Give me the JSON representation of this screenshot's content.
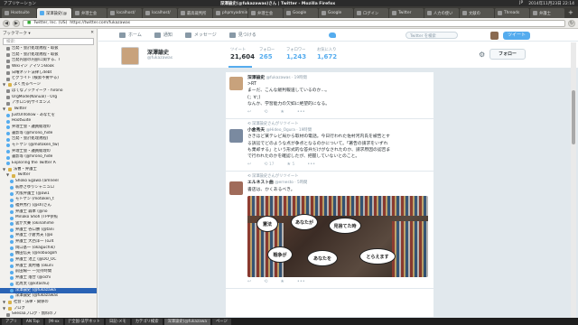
{
  "os": {
    "apps_label": "アプリケーション",
    "title": "深澤諭史(@fukazawas)さん | Twitter - Mozilla Firefox",
    "status": [
      "JP",
      "2014年11月23日 22:14"
    ]
  },
  "tabs": [
    {
      "label": "Hootsuite"
    },
    {
      "label": "深澤諭史(@"
    },
    {
      "label": "弁理士会"
    },
    {
      "label": "localhost/"
    },
    {
      "label": "localhost/"
    },
    {
      "label": "最高裁判所"
    },
    {
      "label": "phpmyadmin"
    },
    {
      "label": "弁理士会"
    },
    {
      "label": "Google"
    },
    {
      "label": "Google"
    },
    {
      "label": "ログイン"
    },
    {
      "label": "Twitter"
    },
    {
      "label": "人力の使い"
    },
    {
      "label": "文献の"
    },
    {
      "label": "Threads"
    },
    {
      "label": "弁護士"
    }
  ],
  "nav": {
    "back_glyph": "◀",
    "forward_glyph": "▶",
    "reload_glyph": "↻",
    "url_site": "Twitter, Inc. (US)",
    "url": "https://twitter.com/fukazawas"
  },
  "sidebar": {
    "title": "ブックマーク ▾",
    "search_placeholder": "検索:",
    "items": [
      {
        "label": "告発・会計処理規程・取扱",
        "type": "page",
        "indent": 1
      },
      {
        "label": "告発・会計処理規程・取扱",
        "type": "page",
        "indent": 1
      },
      {
        "label": "告発内容の内部に関する、T",
        "type": "page",
        "indent": 1
      },
      {
        "label": "Wikiマジ アマゾンBook",
        "type": "page",
        "indent": 1
      },
      {
        "label": "日曜ネット法律しdebt",
        "type": "page",
        "indent": 1
      },
      {
        "label": "ビグライト (検索不要やる)",
        "type": "page",
        "indent": 1
      },
      {
        "label": "よく見るページ",
        "type": "folder",
        "indent": 0
      },
      {
        "label": "はてなブックマーク - hirono",
        "type": "page",
        "indent": 1
      },
      {
        "label": "OrgMode(Nanual) - Org",
        "type": "page",
        "indent": 1
      },
      {
        "label": "アポロン的サイエンス",
        "type": "page",
        "indent": 1
      },
      {
        "label": "Twitter",
        "type": "folder",
        "indent": 0
      },
      {
        "label": "JustUnfollow - あなたを",
        "type": "tw",
        "indent": 1
      },
      {
        "label": "HootSuite",
        "type": "tw",
        "indent": 1
      },
      {
        "label": "弁理士会・議員総理の",
        "type": "tw",
        "indent": 1
      },
      {
        "label": "書影等 (@hirono_hide",
        "type": "tw",
        "indent": 1
      },
      {
        "label": "告発・会計処理規程(",
        "type": "tw",
        "indent": 1
      },
      {
        "label": "モトケン (@motoken_tw)",
        "type": "tw",
        "indent": 1
      },
      {
        "label": "弁理士会・議員総理の",
        "type": "tw",
        "indent": 1
      },
      {
        "label": "書影等 (@hirono_hide",
        "type": "tw",
        "indent": 1
      },
      {
        "label": "Exploring the Twitter A",
        "type": "tw",
        "indent": 1
      },
      {
        "label": "法曹・弁護士",
        "type": "folder",
        "indent": 0
      },
      {
        "label": "Twitter",
        "type": "folder",
        "indent": 1
      },
      {
        "label": "Shoko Egawa (amneel",
        "type": "tw",
        "indent": 2
      },
      {
        "label": "萩原さゆりシャニュロ",
        "type": "tw",
        "indent": 2
      },
      {
        "label": "大阪弁護士 (@aw1",
        "type": "tw",
        "indent": 2
      },
      {
        "label": "モトケン (motoken_t",
        "type": "tw",
        "indent": 2
      },
      {
        "label": "福井秀行 (@sh)さん",
        "type": "tw",
        "indent": 2
      },
      {
        "label": "弁護士 森本 (@no",
        "type": "tw",
        "indent": 2
      },
      {
        "label": "Minako Shoh (TPP参照",
        "type": "tw",
        "indent": 2
      },
      {
        "label": "雲が大乗 (okinahime",
        "type": "tw",
        "indent": 2
      },
      {
        "label": "弁護士 谷口勝 (@tani",
        "type": "tw",
        "indent": 2
      },
      {
        "label": "弁護士 小倉秀夫 (@o",
        "type": "tw",
        "indent": 2
      },
      {
        "label": "弁護士 大西洋一 (o24",
        "type": "tw",
        "indent": 2
      },
      {
        "label": "岡口基一 (okaguchik)",
        "type": "tw",
        "indent": 2
      },
      {
        "label": "鶴田信夫 (@nobuogoh",
        "type": "tw",
        "indent": 2
      },
      {
        "label": "弁護士 池上 (@DO_OC",
        "type": "tw",
        "indent": 2
      },
      {
        "label": "弁護士 奥村徹 (okuni",
        "type": "tw",
        "indent": 2
      },
      {
        "label": "前田陽一 一完持時間",
        "type": "tw",
        "indent": 2
      },
      {
        "label": "弁護士 落合 (@ochi",
        "type": "tw",
        "indent": 2
      },
      {
        "label": "北周太 (@kitashu)",
        "type": "tw",
        "indent": 2
      },
      {
        "label": "深澤諭史 (@fukazawa",
        "type": "tw",
        "indent": 2,
        "selected": true
      },
      {
        "label": "深澤諭史 (@fukazawas",
        "type": "tw",
        "indent": 2
      },
      {
        "label": "社会・法律・関係の",
        "type": "folder",
        "indent": 0
      },
      {
        "label": "ブログ",
        "type": "folder",
        "indent": 0
      },
      {
        "label": "Seesaaブログ - 無料のブ",
        "type": "page",
        "indent": 1
      },
      {
        "label": "ブックマークメニュー",
        "type": "folder",
        "indent": 0
      }
    ]
  },
  "twitter": {
    "nav": [
      {
        "label": "ホーム"
      },
      {
        "label": "通知"
      },
      {
        "label": "メッセージ"
      },
      {
        "label": "見つける"
      }
    ],
    "search_placeholder": "Twitter を検索",
    "tweet_button": "ツイート",
    "profile": {
      "name": "深澤諭史",
      "handle": "@fukazawas",
      "stats": [
        {
          "label": "ツイート",
          "value": "21,604"
        },
        {
          "label": "フォロー",
          "value": "265"
        },
        {
          "label": "フォロワー",
          "value": "1,243"
        },
        {
          "label": "お気に入り",
          "value": "1,672"
        }
      ],
      "follow_button": "フォロー"
    },
    "tweets": [
      {
        "rt_note": "",
        "name": "深澤諭史",
        "handle": "@fukazawas · 19時間",
        "lines": [
          ">RT",
          "まーだ、こんな飯判報道しているのか…。",
          "(；∀；)",
          "なんか、学習能力の欠如に絶望的になる。"
        ],
        "rt_count": "",
        "fav_count": ""
      },
      {
        "rt_note": "深澤諭史さんがリツイート",
        "name": "小倉秀夫",
        "handle": "@Hideo_Ogura · 19時間",
        "lines": [
          "さきほど某テレビ局から取材の電話。今日行われた佐村河内氏を被告とす",
          "る訴訟でどのような点が争点となるのかについて。「著告の請求をいずれ",
          "も棄却する」という形式的な答弁だけがなされたのか、請求原因の認否ま",
          "で行われたのかを確認したが、把握していないとのこと。"
        ],
        "rt_count": "17",
        "fav_count": "5"
      },
      {
        "rt_note": "深澤諭史さんがリツイート",
        "name": "エルネスト曲",
        "handle": "@ernesto · 5時間",
        "lines": [
          "書店は、かくあるべき。"
        ],
        "rt_count": "",
        "fav_count": ""
      }
    ],
    "photo_bubbles": [
      "憲法",
      "あなたが",
      "見捨てた時",
      "戦争が",
      "あなたを",
      "とらえます"
    ]
  },
  "taskbar": [
    {
      "label": "アプリ"
    },
    {
      "label": "AN Top"
    },
    {
      "label": "[M-xx"
    },
    {
      "label": "[\"全国-法学ネット"
    },
    {
      "label": "日記-メモ"
    },
    {
      "label": "カテゴリ検索"
    },
    {
      "label": "深澤諭史(@fukazawa"
    },
    {
      "label": "ページ"
    }
  ]
}
